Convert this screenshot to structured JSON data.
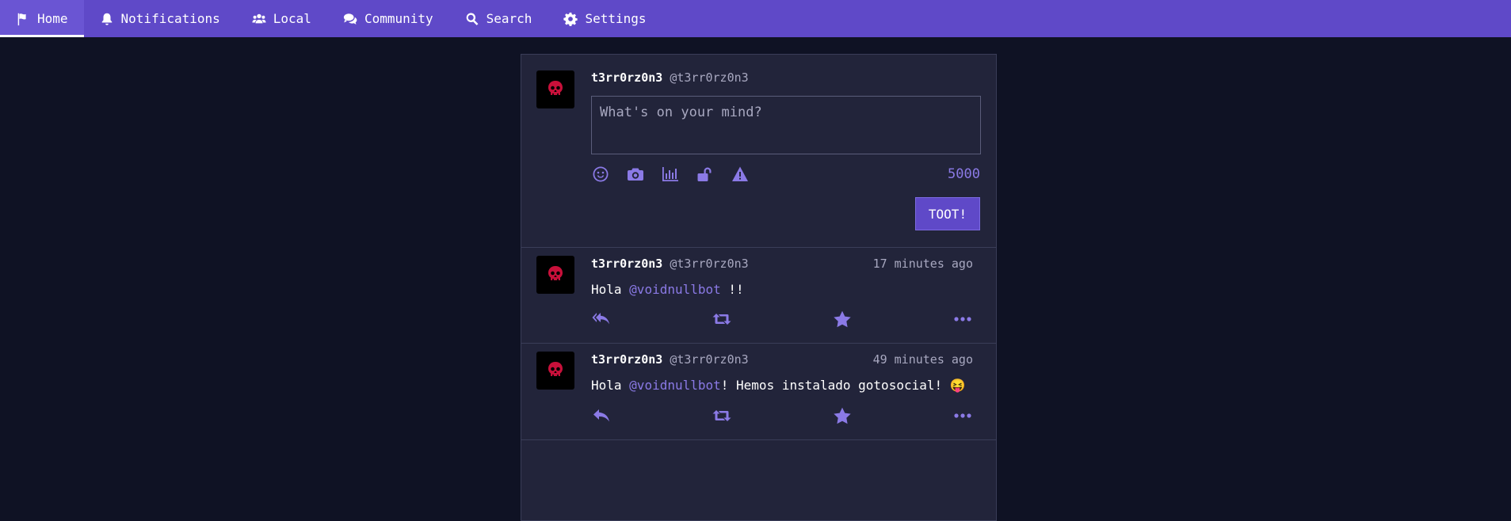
{
  "nav": [
    {
      "label": "Home",
      "icon": "flag-icon",
      "active": true
    },
    {
      "label": "Notifications",
      "icon": "bell-icon"
    },
    {
      "label": "Local",
      "icon": "users-icon"
    },
    {
      "label": "Community",
      "icon": "comments-icon"
    },
    {
      "label": "Search",
      "icon": "search-icon"
    },
    {
      "label": "Settings",
      "icon": "gear-icon"
    }
  ],
  "composer": {
    "display_name": "t3rr0rz0n3",
    "handle": "@t3rr0rz0n3",
    "placeholder": "What's on your mind?",
    "char_count": "5000",
    "submit_label": "TOOT!",
    "tools": [
      "emoji-icon",
      "camera-icon",
      "poll-icon",
      "unlock-icon",
      "warning-icon"
    ]
  },
  "statuses": [
    {
      "display_name": "t3rr0rz0n3",
      "handle": "@t3rr0rz0n3",
      "time": "17 minutes ago",
      "text_before": "Hola ",
      "mention": "@voidnullbot",
      "text_after": " !!"
    },
    {
      "display_name": "t3rr0rz0n3",
      "handle": "@t3rr0rz0n3",
      "time": "49 minutes ago",
      "text_before": "Hola ",
      "mention": "@voidnullbot",
      "text_after": "! Hemos instalado gotosocial! 😝"
    }
  ],
  "colors": {
    "nav_bg": "#5f49c8",
    "page_bg": "#0f1224",
    "column_bg": "#22243a",
    "accent": "#8b7ae6"
  }
}
